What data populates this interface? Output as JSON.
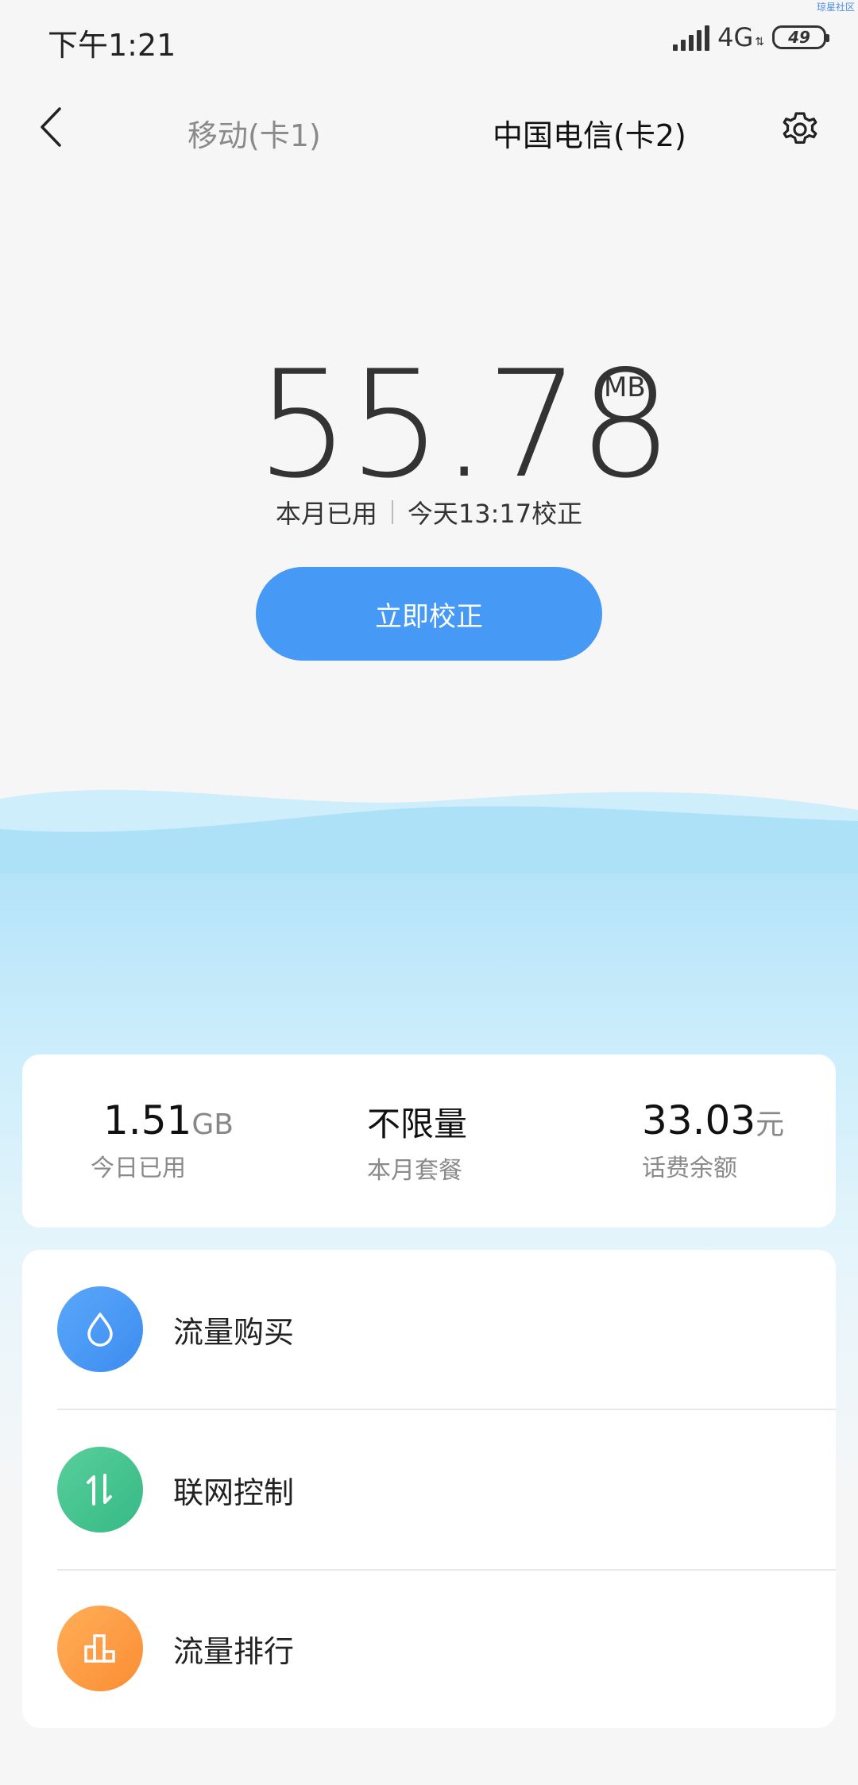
{
  "status_bar": {
    "time": "下午1:21",
    "network": "4G",
    "battery": "49",
    "watermark": "琼星社区"
  },
  "header": {
    "tabs": [
      {
        "label": "移动(卡1)",
        "selected": false
      },
      {
        "label": "中国电信(卡2)",
        "selected": true
      }
    ]
  },
  "usage": {
    "value": "55.78",
    "unit": "MB",
    "label": "本月已用",
    "calibrated": "今天13:17校正"
  },
  "calibrate_button": "立即校正",
  "stats": {
    "today": {
      "value": "1.51",
      "unit": "GB",
      "label": "今日已用"
    },
    "plan": {
      "value": "不限量",
      "label": "本月套餐"
    },
    "balance": {
      "value": "33.03",
      "unit": "元",
      "label": "话费余额"
    }
  },
  "menu": [
    {
      "label": "流量购买",
      "icon": "droplet-icon",
      "color": "#4699f4"
    },
    {
      "label": "联网控制",
      "icon": "updown-arrows-icon",
      "color": "#44c48f"
    },
    {
      "label": "流量排行",
      "icon": "bar-chart-icon",
      "color": "#fd9a42"
    }
  ]
}
